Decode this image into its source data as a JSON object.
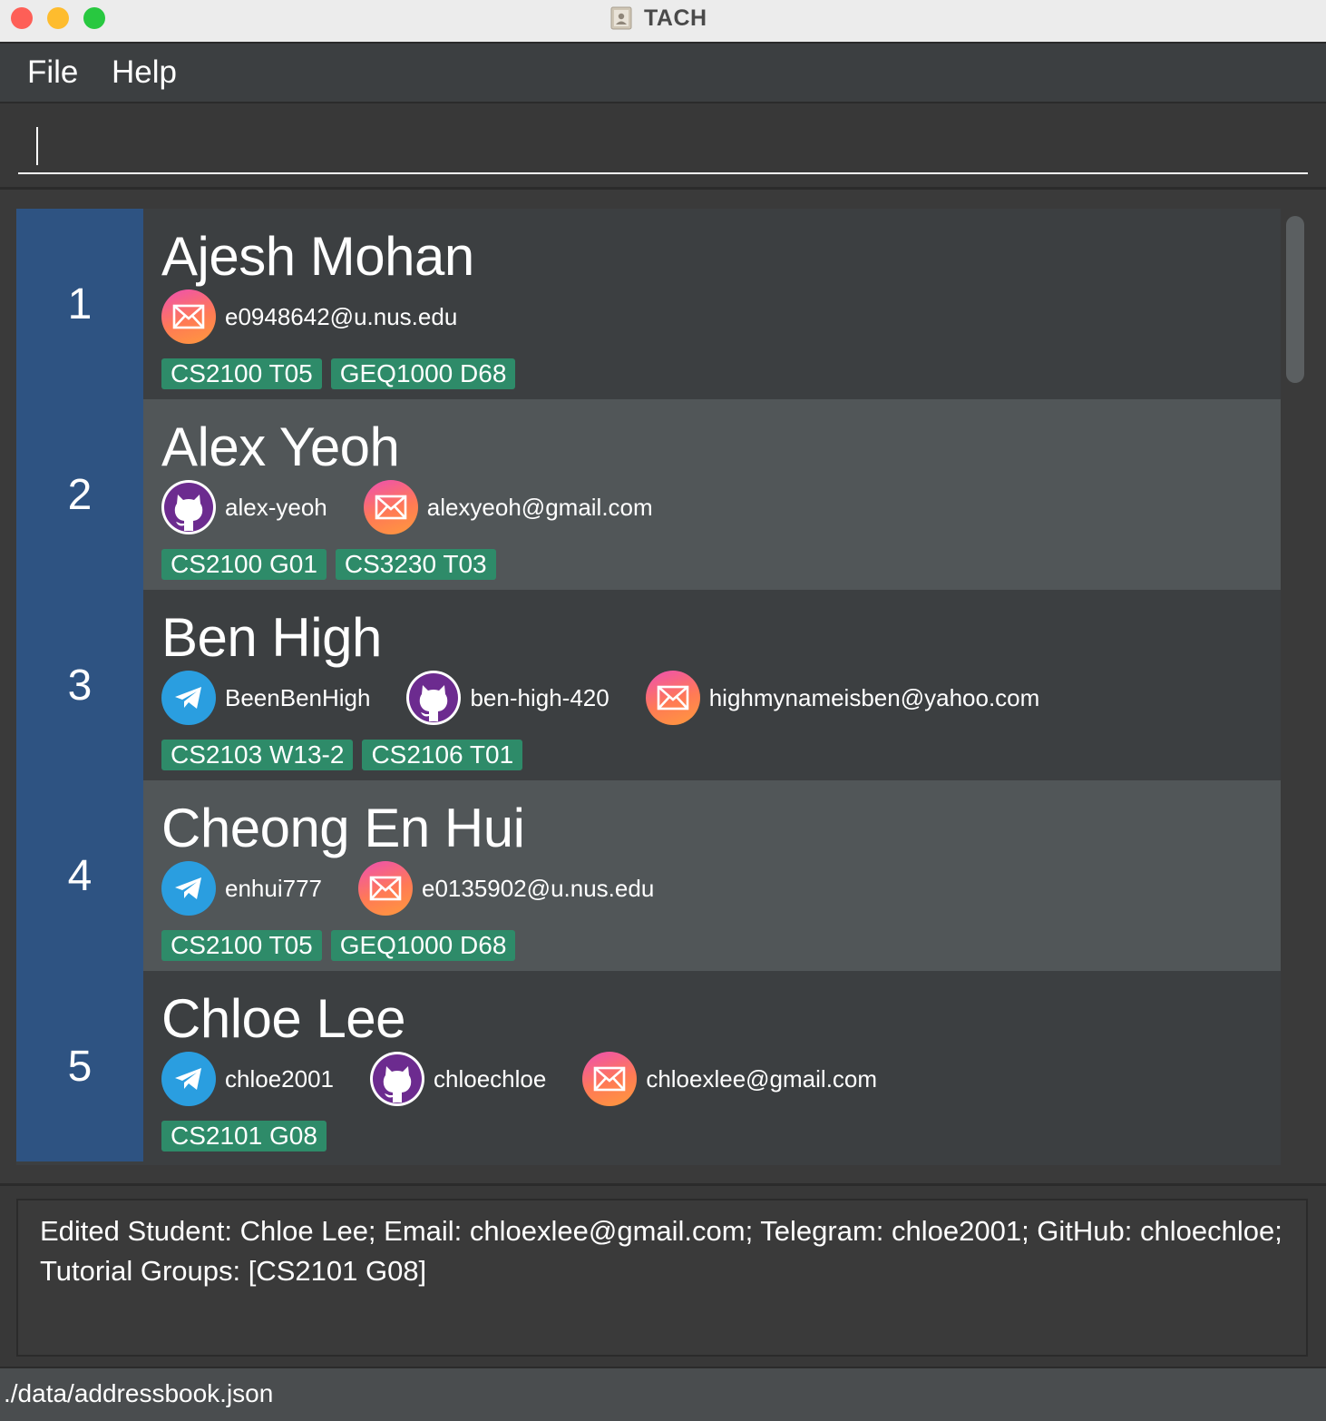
{
  "window": {
    "title": "TACH"
  },
  "menu": {
    "file": "File",
    "help": "Help"
  },
  "command": {
    "value": "",
    "placeholder": ""
  },
  "persons": [
    {
      "index": "1",
      "name": "Ajesh Mohan",
      "telegram": "",
      "github": "",
      "email": "e0948642@u.nus.edu",
      "tags": [
        "CS2100 T05",
        "GEQ1000 D68"
      ]
    },
    {
      "index": "2",
      "name": "Alex Yeoh",
      "telegram": "",
      "github": "alex-yeoh",
      "email": "alexyeoh@gmail.com",
      "tags": [
        "CS2100 G01",
        "CS3230 T03"
      ]
    },
    {
      "index": "3",
      "name": "Ben High",
      "telegram": "BeenBenHigh",
      "github": "ben-high-420",
      "email": "highmynameisben@yahoo.com",
      "tags": [
        "CS2103 W13-2",
        "CS2106 T01"
      ]
    },
    {
      "index": "4",
      "name": "Cheong En Hui",
      "telegram": "enhui777",
      "github": "",
      "email": "e0135902@u.nus.edu",
      "tags": [
        "CS2100 T05",
        "GEQ1000 D68"
      ]
    },
    {
      "index": "5",
      "name": "Chloe Lee",
      "telegram": "chloe2001",
      "github": "chloechloe",
      "email": "chloexlee@gmail.com",
      "tags": [
        "CS2101 G08"
      ]
    }
  ],
  "result": {
    "text": "Edited Student: Chloe Lee; Email: chloexlee@gmail.com; Telegram: chloe2001; GitHub: chloechloe; Tutorial Groups: [CS2101 G08]"
  },
  "status": {
    "path": "./data/addressbook.json"
  },
  "colors": {
    "index_panel": "#2e5382",
    "tag": "#2e8b69",
    "telegram": "#2a9ee0",
    "github": "#6c2b8f",
    "email_start": "#ee4fb3",
    "email_end": "#ff9a3c"
  }
}
